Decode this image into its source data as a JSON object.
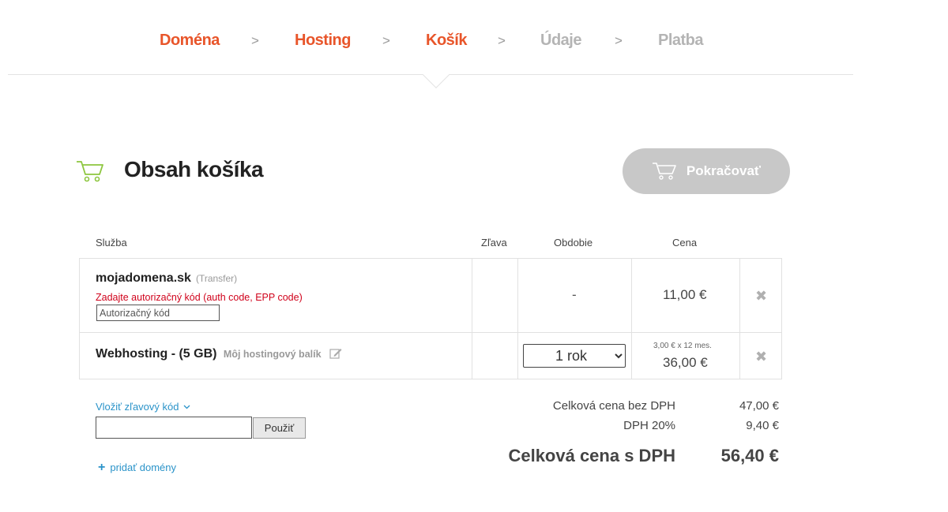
{
  "steps": [
    {
      "label": "Doména"
    },
    {
      "label": "Hosting"
    },
    {
      "label": "Košík"
    },
    {
      "label": "Údaje"
    },
    {
      "label": "Platba"
    }
  ],
  "step_separator": ">",
  "header": {
    "title": "Obsah košíka",
    "continue_label": "Pokračovať"
  },
  "table": {
    "columns": {
      "service": "Služba",
      "discount": "Zľava",
      "period": "Obdobie",
      "price": "Cena"
    },
    "items": [
      {
        "name": "mojadomena.sk",
        "type": "(Transfer)",
        "warning": "Zadajte autorizačný kód (auth code, EPP code)",
        "auth_placeholder": "Autorizačný kód",
        "period": "-",
        "price": "11,00 €"
      },
      {
        "name": "Webhosting - (5 GB)",
        "label": "Môj hostingový balík",
        "period": "1 rok",
        "price_detail": "3,00 € x 12 mes.",
        "price": "36,00 €"
      }
    ],
    "remove_glyph": "✖"
  },
  "discount": {
    "link_label": "Vložiť zľavový kód",
    "apply_label": "Použiť"
  },
  "add_domains_label": "pridať domény",
  "totals": {
    "net_label": "Celková cena bez DPH",
    "net_value": "47,00 €",
    "vat_label": "DPH 20%",
    "vat_value": "9,40 €",
    "gross_label": "Celková cena s DPH",
    "gross_value": "56,40 €"
  },
  "colors": {
    "step_active": "#e8552a",
    "step_inactive": "#b4b4b4",
    "link": "#2a93c9",
    "warning": "#d0021b",
    "cart_icon": "#8dc63f",
    "button_disabled": "#c8c8c8"
  }
}
